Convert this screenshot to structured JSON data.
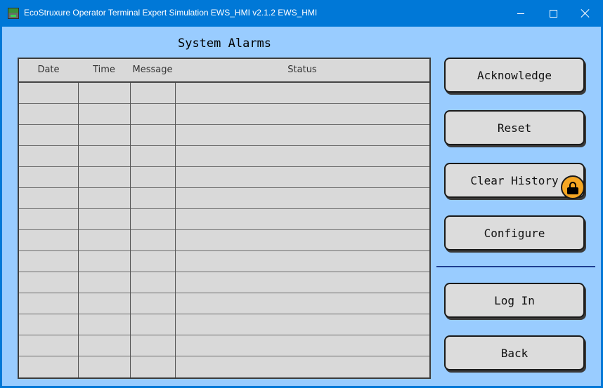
{
  "window": {
    "title": "EcoStruxure Operator Terminal Expert Simulation EWS_HMI v2.1.2 EWS_HMI",
    "icon": "app-icon",
    "controls": [
      "minimize-icon",
      "maximize-icon",
      "close-icon"
    ]
  },
  "screen": {
    "title": "System Alarms"
  },
  "alarm_table": {
    "columns": [
      "Date",
      "Time",
      "Message",
      "Status"
    ],
    "rows": [
      {
        "date": "",
        "time": "",
        "message": "",
        "status": ""
      },
      {
        "date": "",
        "time": "",
        "message": "",
        "status": ""
      },
      {
        "date": "",
        "time": "",
        "message": "",
        "status": ""
      },
      {
        "date": "",
        "time": "",
        "message": "",
        "status": ""
      },
      {
        "date": "",
        "time": "",
        "message": "",
        "status": ""
      },
      {
        "date": "",
        "time": "",
        "message": "",
        "status": ""
      },
      {
        "date": "",
        "time": "",
        "message": "",
        "status": ""
      },
      {
        "date": "",
        "time": "",
        "message": "",
        "status": ""
      },
      {
        "date": "",
        "time": "",
        "message": "",
        "status": ""
      },
      {
        "date": "",
        "time": "",
        "message": "",
        "status": ""
      },
      {
        "date": "",
        "time": "",
        "message": "",
        "status": ""
      },
      {
        "date": "",
        "time": "",
        "message": "",
        "status": ""
      },
      {
        "date": "",
        "time": "",
        "message": "",
        "status": ""
      },
      {
        "date": "",
        "time": "",
        "message": "",
        "status": ""
      }
    ]
  },
  "buttons": {
    "acknowledge": "Acknowledge",
    "reset": "Reset",
    "clear_history": "Clear History",
    "configure": "Configure",
    "log_in": "Log In",
    "back": "Back"
  },
  "icons": {
    "lock": "lock-icon"
  },
  "colors": {
    "titlebar": "#0078d7",
    "background": "#99ccff",
    "table": "#d9d9d9",
    "button": "#dcdcdc",
    "lock": "#f5a623",
    "separator": "#1f3d91"
  }
}
